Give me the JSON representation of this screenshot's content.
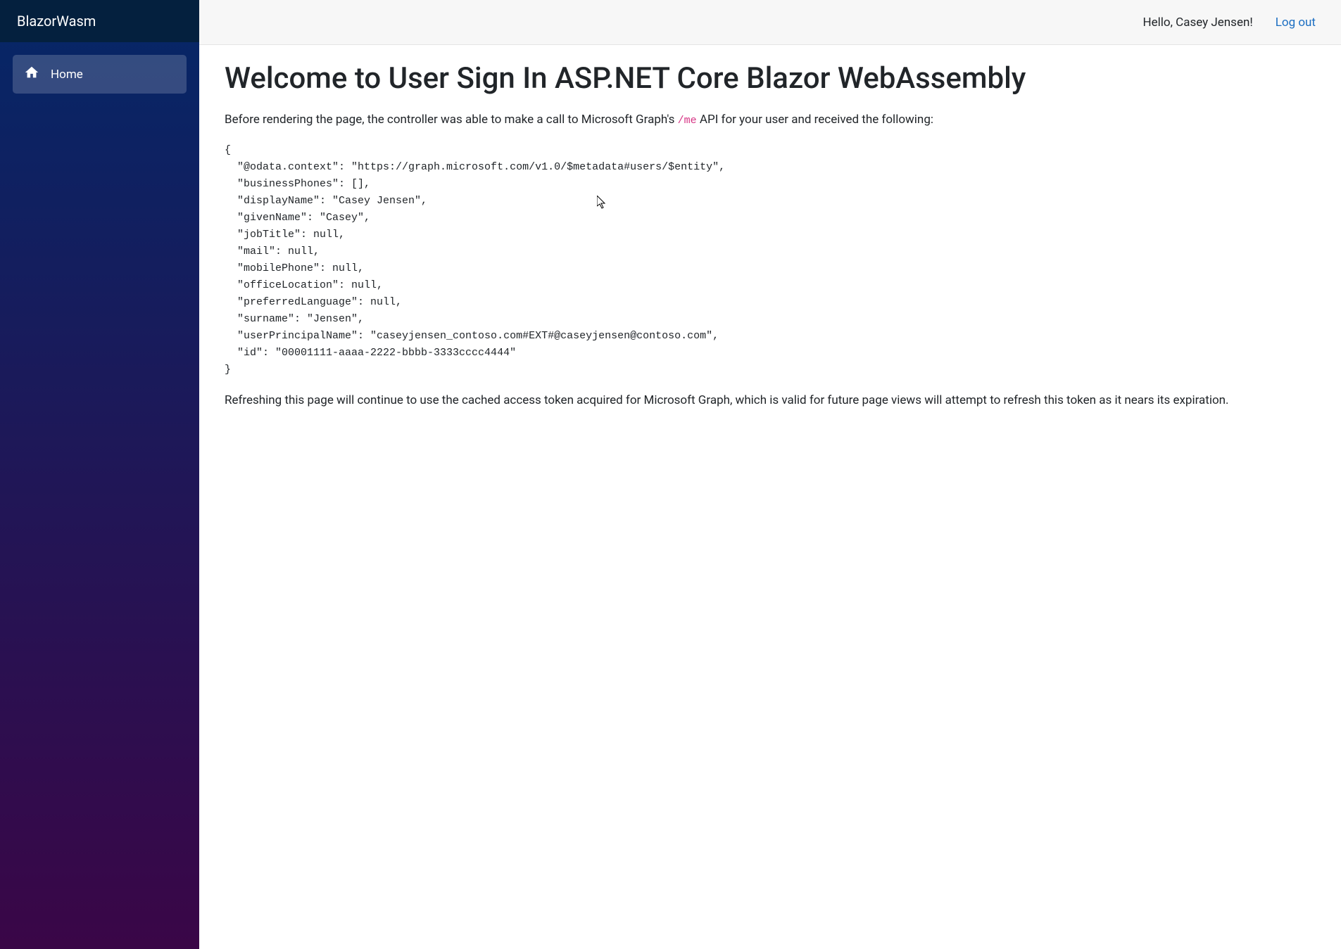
{
  "brand": "BlazorWasm",
  "sidebar": {
    "items": [
      {
        "label": "Home",
        "icon": "home-icon"
      }
    ]
  },
  "header": {
    "greeting": "Hello, Casey Jensen!",
    "logout": "Log out"
  },
  "main": {
    "title": "Welcome to User Sign In ASP.NET Core Blazor WebAssembly",
    "intro_before": "Before rendering the page, the controller was able to make a call to Microsoft Graph's ",
    "intro_code": "/me",
    "intro_after": " API for your user and received the following:",
    "json_block": "{\n  \"@odata.context\": \"https://graph.microsoft.com/v1.0/$metadata#users/$entity\",\n  \"businessPhones\": [],\n  \"displayName\": \"Casey Jensen\",\n  \"givenName\": \"Casey\",\n  \"jobTitle\": null,\n  \"mail\": null,\n  \"mobilePhone\": null,\n  \"officeLocation\": null,\n  \"preferredLanguage\": null,\n  \"surname\": \"Jensen\",\n  \"userPrincipalName\": \"caseyjensen_contoso.com#EXT#@caseyjensen@contoso.com\",\n  \"id\": \"00001111-aaaa-2222-bbbb-3333cccc4444\"\n}",
    "footer_text": "Refreshing this page will continue to use the cached access token acquired for Microsoft Graph, which is valid for future page views will attempt to refresh this token as it nears its expiration."
  }
}
